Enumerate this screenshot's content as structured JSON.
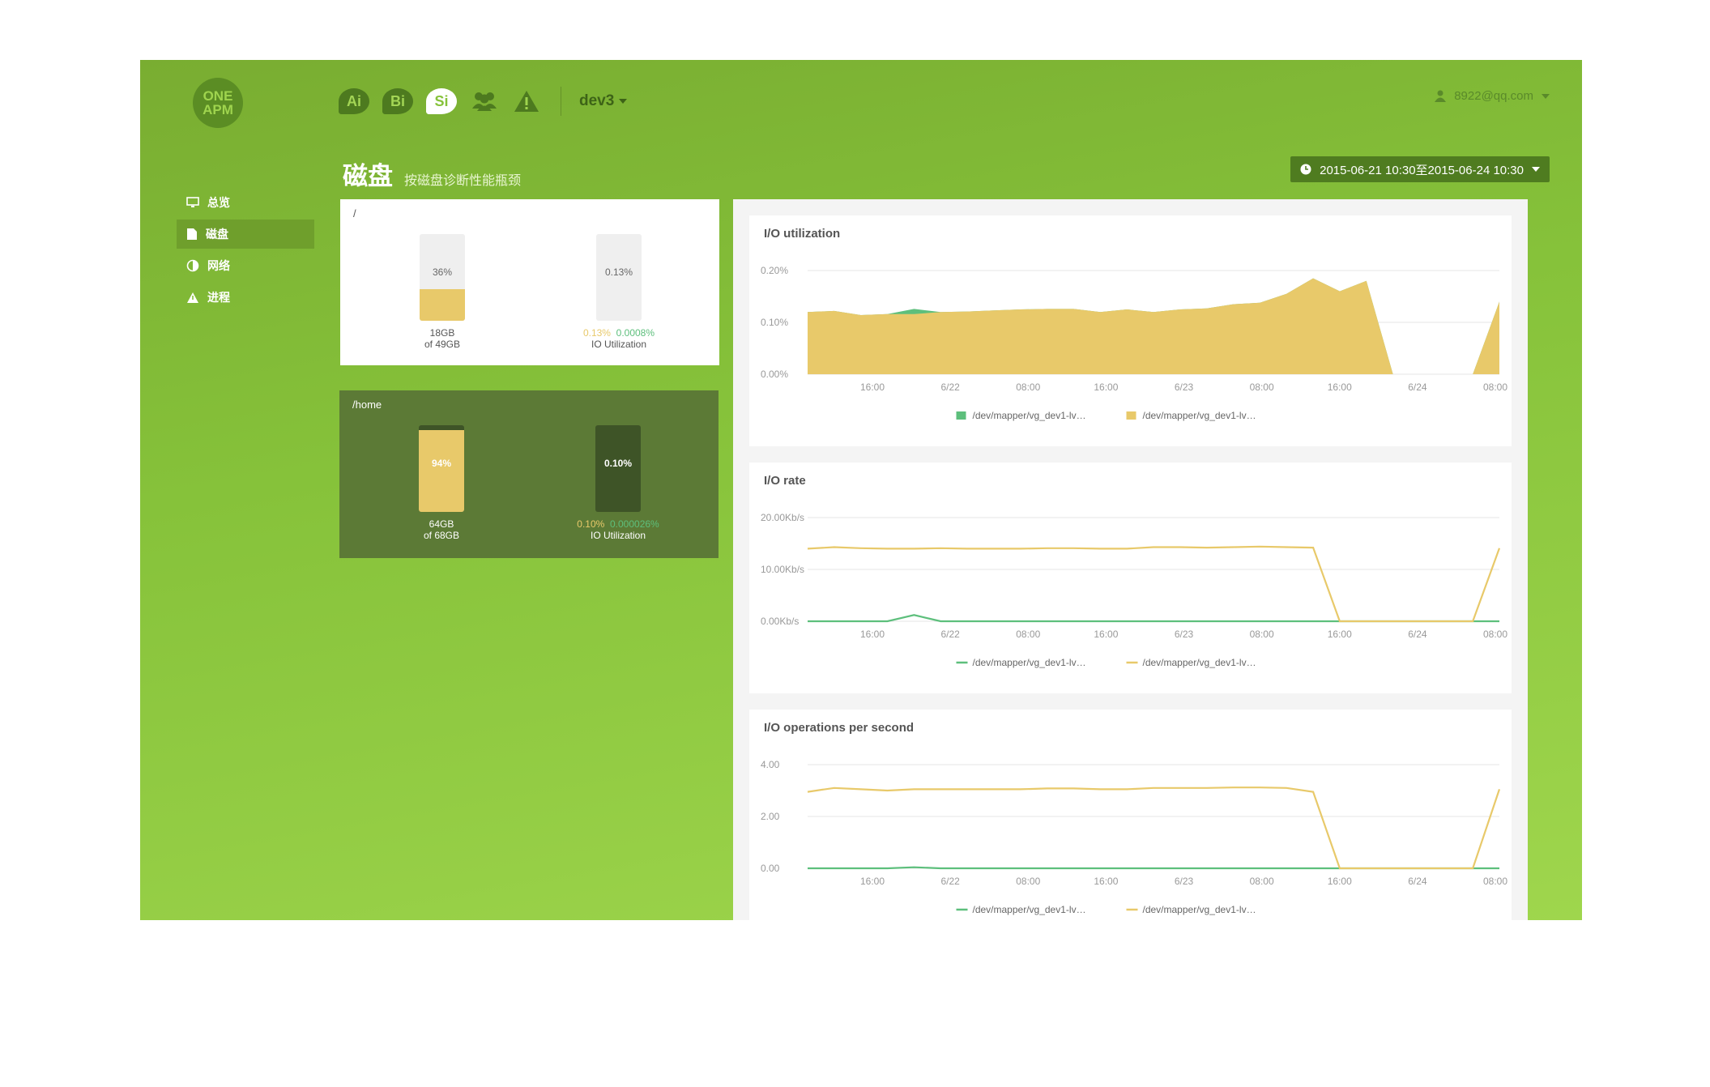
{
  "app": {
    "logo_line1": "ONE",
    "logo_line2": "APM",
    "products": [
      {
        "label": "Ai",
        "active": false
      },
      {
        "label": "Bi",
        "active": false
      },
      {
        "label": "Si",
        "active": true
      }
    ],
    "env": "dev3",
    "user_email": "8922@qq.com"
  },
  "sidebar": {
    "items": [
      {
        "label": "总览",
        "icon": "monitor-icon",
        "active": false
      },
      {
        "label": "磁盘",
        "icon": "disk-icon",
        "active": true
      },
      {
        "label": "网络",
        "icon": "network-icon",
        "active": false
      },
      {
        "label": "进程",
        "icon": "process-icon",
        "active": false
      }
    ]
  },
  "page": {
    "title": "磁盘",
    "subtitle": "按磁盘诊断性能瓶颈",
    "date_range": "2015-06-21 10:30至2015-06-24 10:30"
  },
  "disks": [
    {
      "mount": "/",
      "usage_pct": 0.36,
      "usage_label": "36%",
      "used": "18GB",
      "total": "of 49GB",
      "io_pct": 0.0013,
      "io_label": "0.13%",
      "io_a": "0.13%",
      "io_b": "0.0008%",
      "io_caption": "IO Utilization"
    },
    {
      "mount": "/home",
      "usage_pct": 0.94,
      "usage_label": "94%",
      "used": "64GB",
      "total": "of 68GB",
      "io_pct": 0.001,
      "io_label": "0.10%",
      "io_a": "0.10%",
      "io_b": "0.000026%",
      "io_caption": "IO Utilization"
    }
  ],
  "colors": {
    "yellow": "#e8c96a",
    "green": "#5dbf7c",
    "accent": "#86c23a"
  },
  "chart_data": [
    {
      "type": "area",
      "title": "I/O utilization",
      "yticks": [
        "0.20%",
        "0.10%",
        "0.00%"
      ],
      "ylim": [
        0,
        0.2
      ],
      "xticks": [
        "16:00",
        "6/22",
        "08:00",
        "16:00",
        "6/23",
        "08:00",
        "16:00",
        "6/24",
        "08:00"
      ],
      "series": [
        {
          "name": "/dev/mapper/vg_dev1-lv…",
          "color": "#5dbf7c",
          "values": [
            0.12,
            0.122,
            0.114,
            0.116,
            0.126,
            0.12,
            0.121,
            0.123,
            0.125,
            0.126,
            0.126,
            0.12,
            0.125,
            0.12,
            0.125,
            0.127,
            0.135,
            0.138,
            0.155,
            0.185,
            0.16,
            0.18,
            0,
            0,
            0,
            0,
            0.14
          ]
        },
        {
          "name": "/dev/mapper/vg_dev1-lv…",
          "color": "#e8c96a",
          "values": [
            0.12,
            0.122,
            0.114,
            0.116,
            0.116,
            0.12,
            0.121,
            0.123,
            0.125,
            0.126,
            0.126,
            0.12,
            0.125,
            0.12,
            0.125,
            0.127,
            0.135,
            0.138,
            0.155,
            0.185,
            0.16,
            0.18,
            0,
            0,
            0,
            0,
            0.14
          ]
        }
      ],
      "legend": "bottom-center",
      "grid": true
    },
    {
      "type": "line",
      "title": "I/O rate",
      "yticks": [
        "20.00Kb/s",
        "10.00Kb/s",
        "0.00Kb/s"
      ],
      "ylim": [
        0,
        20
      ],
      "xticks": [
        "16:00",
        "6/22",
        "08:00",
        "16:00",
        "6/23",
        "08:00",
        "16:00",
        "6/24",
        "08:00"
      ],
      "series": [
        {
          "name": "/dev/mapper/vg_dev1-lv…",
          "color": "#5dbf7c",
          "values": [
            0,
            0,
            0,
            0,
            1.2,
            0,
            0,
            0,
            0,
            0,
            0,
            0,
            0,
            0,
            0,
            0,
            0,
            0,
            0,
            0,
            0,
            0,
            0,
            0,
            0,
            0,
            0
          ]
        },
        {
          "name": "/dev/mapper/vg_dev1-lv…",
          "color": "#e8c96a",
          "values": [
            14.0,
            14.3,
            14.1,
            14.0,
            14.0,
            14.1,
            14.0,
            14.0,
            14.0,
            14.1,
            14.1,
            14.0,
            14.0,
            14.3,
            14.3,
            14.2,
            14.3,
            14.4,
            14.3,
            14.2,
            0,
            0,
            0,
            0,
            0,
            0,
            14.1
          ]
        }
      ],
      "legend": "bottom-center",
      "grid": true
    },
    {
      "type": "line",
      "title": "I/O operations per second",
      "yticks": [
        "4.00",
        "2.00",
        "0.00"
      ],
      "ylim": [
        0,
        4
      ],
      "xticks": [
        "16:00",
        "6/22",
        "08:00",
        "16:00",
        "6/23",
        "08:00",
        "16:00",
        "6/24",
        "08:00"
      ],
      "series": [
        {
          "name": "/dev/mapper/vg_dev1-lv…",
          "color": "#5dbf7c",
          "values": [
            0,
            0,
            0,
            0,
            0.04,
            0,
            0,
            0,
            0,
            0,
            0,
            0,
            0,
            0,
            0,
            0,
            0,
            0,
            0,
            0,
            0,
            0,
            0,
            0,
            0,
            0,
            0
          ]
        },
        {
          "name": "/dev/mapper/vg_dev1-lv…",
          "color": "#e8c96a",
          "values": [
            2.95,
            3.1,
            3.05,
            3.0,
            3.05,
            3.05,
            3.05,
            3.05,
            3.05,
            3.08,
            3.08,
            3.05,
            3.05,
            3.1,
            3.1,
            3.1,
            3.12,
            3.12,
            3.1,
            2.95,
            0,
            0,
            0,
            0,
            0,
            0,
            3.05
          ]
        }
      ],
      "legend": "bottom-center",
      "grid": true
    }
  ]
}
